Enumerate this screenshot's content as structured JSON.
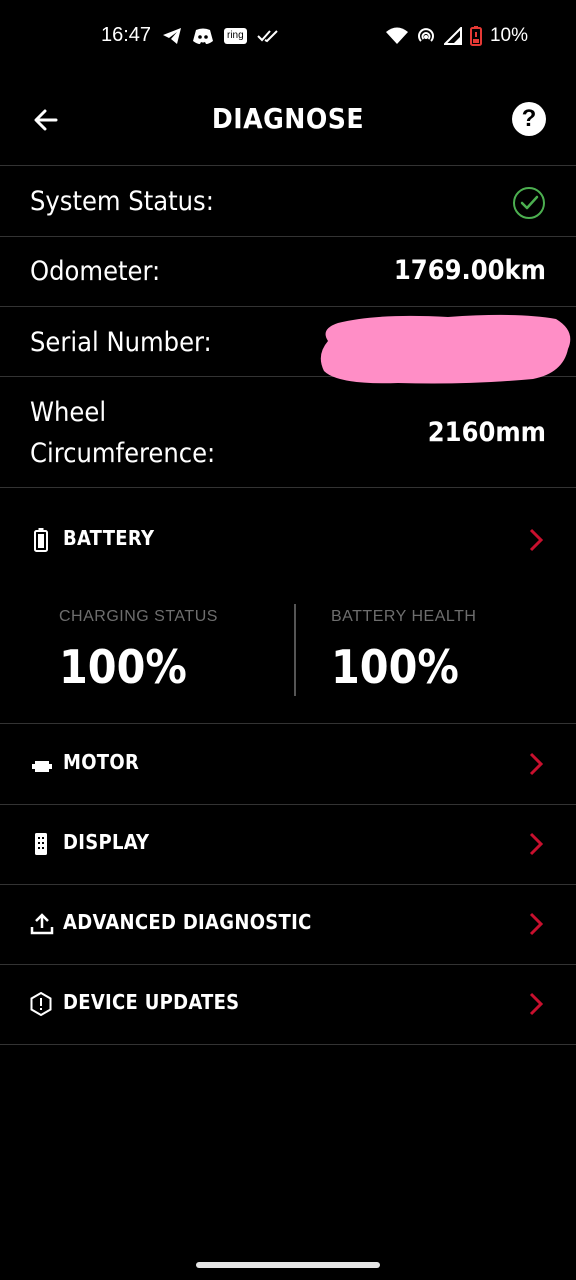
{
  "status_bar": {
    "time": "16:47",
    "ring_label": "ring",
    "battery_percent": "10%",
    "icons_left": [
      "telegram-icon",
      "discord-icon",
      "ring-icon",
      "double-check-icon"
    ],
    "icons_right": [
      "wifi-icon",
      "hotspot-icon",
      "signal-icon",
      "battery-low-icon"
    ]
  },
  "header": {
    "title": "DIAGNOSE",
    "help_label": "?"
  },
  "info": {
    "system_status_label": "System Status:",
    "odometer_label": "Odometer:",
    "odometer_value": "1769.00km",
    "serial_label": "Serial Number:",
    "wheel_label_line1": "Wheel",
    "wheel_label_line2": "Circumference:",
    "wheel_value": "2160mm"
  },
  "battery": {
    "label": "BATTERY",
    "charging_label": "CHARGING STATUS",
    "charging_value": "100%",
    "health_label": "BATTERY HEALTH",
    "health_value": "100%"
  },
  "menu": {
    "motor": "MOTOR",
    "display": "DISPLAY",
    "advanced": "ADVANCED DIAGNOSTIC",
    "updates": "DEVICE UPDATES"
  },
  "colors": {
    "background": "#000000",
    "accent_red": "#c8102e",
    "status_ok_green": "#4caf50",
    "redaction_pink": "#ff8ec6"
  }
}
